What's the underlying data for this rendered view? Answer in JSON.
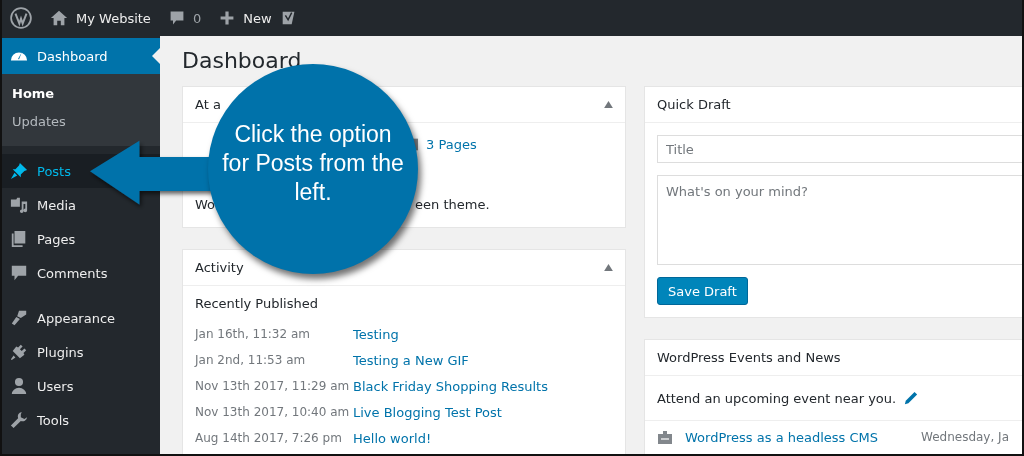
{
  "admin_bar": {
    "site_name": "My Website",
    "comments_count": "0",
    "new_label": "New"
  },
  "sidebar": {
    "items": [
      {
        "label": "Dashboard",
        "selected": true,
        "hovered": false,
        "children": [
          {
            "label": "Home",
            "selected": true
          },
          {
            "label": "Updates",
            "selected": false
          }
        ]
      },
      {
        "label": "Posts",
        "selected": false,
        "hovered": true
      },
      {
        "label": "Media",
        "selected": false,
        "hovered": false
      },
      {
        "label": "Pages",
        "selected": false,
        "hovered": false
      },
      {
        "label": "Comments",
        "selected": false,
        "hovered": false
      },
      {
        "label": "Appearance",
        "selected": false,
        "hovered": false
      },
      {
        "label": "Plugins",
        "selected": false,
        "hovered": false
      },
      {
        "label": "Users",
        "selected": false,
        "hovered": false
      },
      {
        "label": "Tools",
        "selected": false,
        "hovered": false
      }
    ]
  },
  "page_title": "Dashboard",
  "at_a_glance": {
    "title": "At a",
    "pages_link": "3 Pages",
    "theme_text_start": "Wo",
    "theme_text_end": "een theme."
  },
  "activity": {
    "title": "Activity",
    "section": "Recently Published",
    "posts": [
      {
        "date": "Jan 16th, 11:32 am",
        "title": "Testing"
      },
      {
        "date": "Jan 2nd, 11:53 am",
        "title": "Testing a New GIF"
      },
      {
        "date": "Nov 13th 2017, 11:29 am",
        "title": "Black Friday Shopping Results"
      },
      {
        "date": "Nov 13th 2017, 10:40 am",
        "title": "Live Blogging Test Post"
      },
      {
        "date": "Aug 14th 2017, 7:26 pm",
        "title": "Hello world!"
      }
    ]
  },
  "quick_draft": {
    "title": "Quick Draft",
    "title_placeholder": "Title",
    "content_placeholder": "What's on your mind?",
    "button": "Save Draft"
  },
  "events": {
    "title": "WordPress Events and News",
    "intro": "Attend an upcoming event near you.",
    "items": [
      {
        "title": "WordPress as a headless CMS",
        "date": "Wednesday, Ja"
      }
    ]
  },
  "callout": {
    "text": "Click the option for Posts from the left."
  }
}
